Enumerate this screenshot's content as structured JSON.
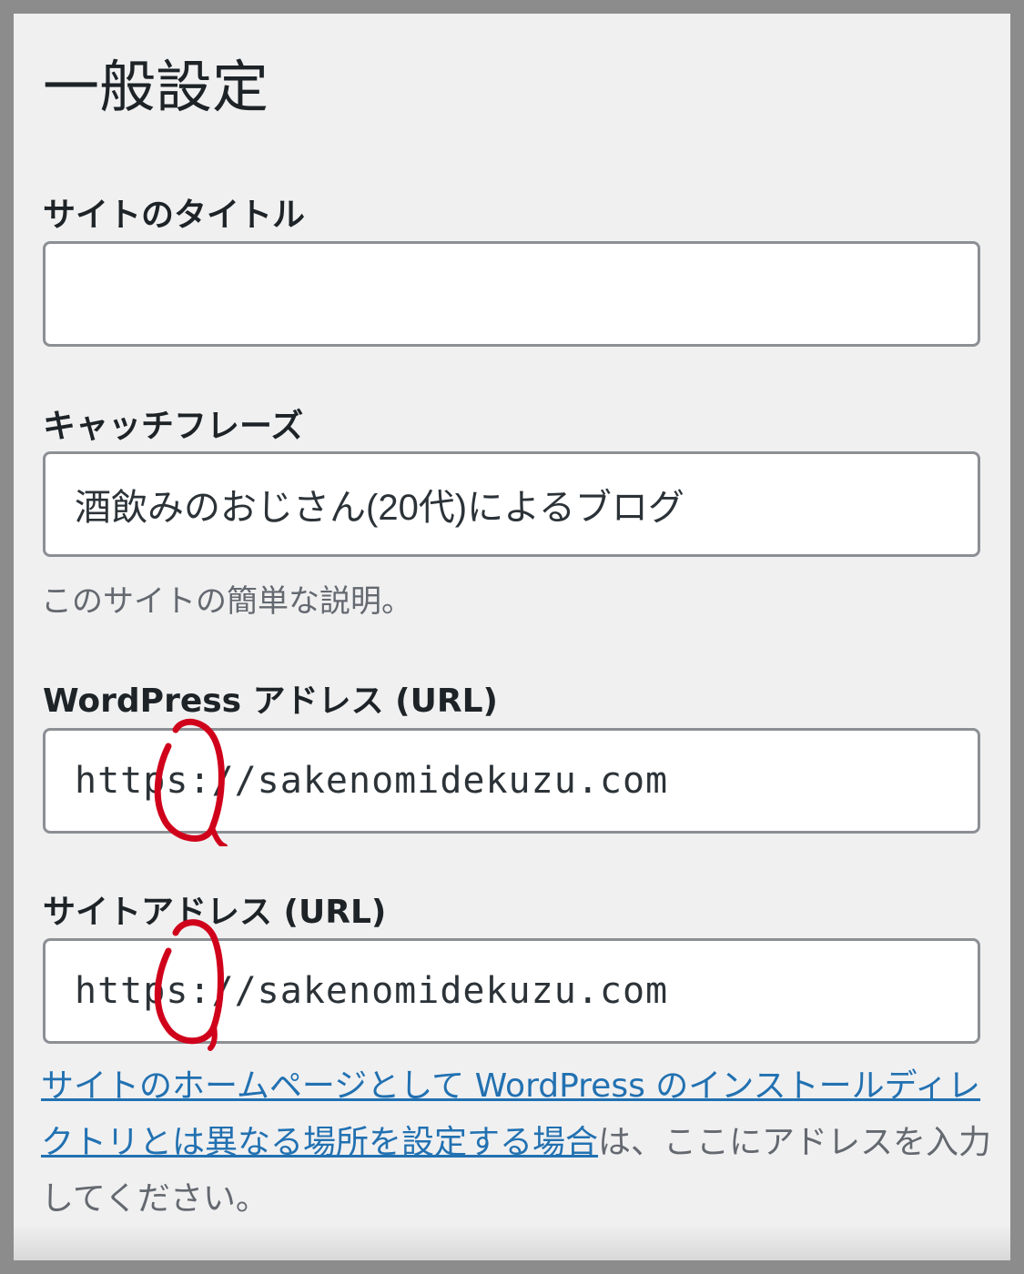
{
  "page": {
    "title": "一般設定"
  },
  "fields": {
    "site_title": {
      "label": "サイトのタイトル",
      "value": ""
    },
    "tagline": {
      "label": "キャッチフレーズ",
      "value": "酒飲みのおじさん(20代)によるブログ",
      "description": "このサイトの簡単な説明。"
    },
    "wordpress_address": {
      "label": "WordPress アドレス (URL)",
      "value": "https://sakenomidekuzu.com"
    },
    "site_address": {
      "label": "サイトアドレス (URL)",
      "value": "https://sakenomidekuzu.com",
      "help_link": "サイトのホームページとして WordPress のインストールディレクトリとは異なる場所を設定する場合",
      "help_text": "は、ここにアドレスを入力してください。"
    }
  },
  "colors": {
    "annotation": "#d0021b",
    "link": "#2271b1"
  }
}
